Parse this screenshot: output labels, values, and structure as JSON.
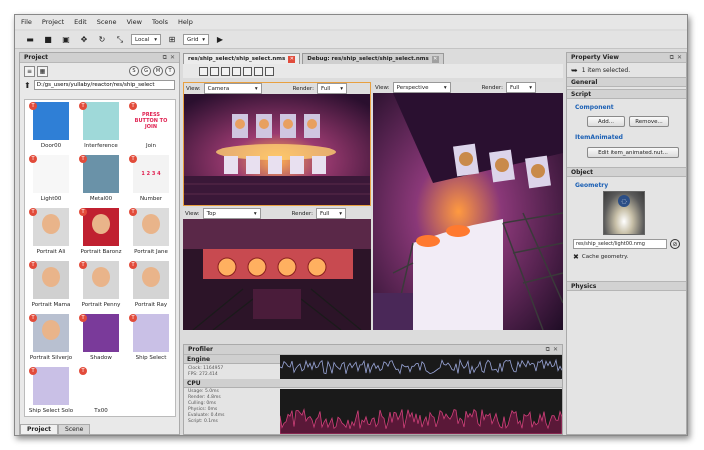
{
  "menu": [
    "File",
    "Project",
    "Edit",
    "Scene",
    "View",
    "Tools",
    "Help"
  ],
  "toolbar": {
    "space": "Local",
    "snap": "Grid"
  },
  "project": {
    "title": "Project",
    "path": "D:/gs_users/yullaby/reactor/res/ship_select",
    "assets": [
      {
        "label": "Door00",
        "bg": "#2f7fd6"
      },
      {
        "label": "Interference",
        "bg": "#9fd9d9"
      },
      {
        "label": "Join",
        "bg": "#ffffff",
        "text": "PRESS BUTTON TO JOIN"
      },
      {
        "label": "Light00",
        "bg": "#f7f7f7"
      },
      {
        "label": "Metal00",
        "bg": "#6a92a8"
      },
      {
        "label": "Number",
        "bg": "#f3f3f3",
        "text": "1 2 3 4"
      },
      {
        "label": "Portrait Ali",
        "bg": "#d9d9d9"
      },
      {
        "label": "Portrait Baronz",
        "bg": "#c02030"
      },
      {
        "label": "Portrait Jane",
        "bg": "#dcdcdc"
      },
      {
        "label": "Portrait Mama",
        "bg": "#d0d0d0"
      },
      {
        "label": "Portrait Penny",
        "bg": "#d6d6d6"
      },
      {
        "label": "Portrait Ray",
        "bg": "#d4d4d4"
      },
      {
        "label": "Portrait Silverjo",
        "bg": "#b8c0d0"
      },
      {
        "label": "Shadow",
        "bg": "#7a3a9a"
      },
      {
        "label": "Ship Select",
        "bg": "#c9c0e6"
      },
      {
        "label": "Ship Select Solo",
        "bg": "#c9c0e6"
      },
      {
        "label": "Tx00",
        "bg": "#ffffff"
      }
    ],
    "tabs": [
      "Project",
      "Scene"
    ]
  },
  "documents": [
    {
      "label": "res/ship_select/ship_select.nms",
      "active": true
    },
    {
      "label": "Debug: res/ship_select/ship_select.nms",
      "active": false
    }
  ],
  "viewports": {
    "camera": {
      "view_label": "View:",
      "view": "Camera",
      "render_label": "Render:",
      "render": "Full"
    },
    "perspective": {
      "view_label": "View:",
      "view": "Perspective",
      "render_label": "Render:",
      "render": "Full"
    },
    "top": {
      "view_label": "View:",
      "view": "Top",
      "render_label": "Render:",
      "render": "Full"
    }
  },
  "profiler": {
    "title": "Profiler",
    "engine": {
      "title": "Engine",
      "stats": [
        "Clock: 1164957",
        "FPS: 272.414"
      ]
    },
    "cpu": {
      "title": "CPU",
      "stats": [
        "Usage: 5.0ms",
        "Render: 4.8ms",
        "Culling: 0ms",
        "Physics: 0ms",
        "Evaluate: 0.4ms",
        "Script: 0.1ms"
      ]
    }
  },
  "property": {
    "title": "Property View",
    "selected": "1 item selected.",
    "general": "General",
    "script": "Script",
    "component": "Component",
    "add": "Add...",
    "remove": "Remove...",
    "item_animated": "ItemAnimated",
    "edit_item": "Edit item_animated.nut...",
    "object": "Object",
    "geometry": "Geometry",
    "geometry_path": "res/ship_select/light00.nmg",
    "cache": "Cache geometry.",
    "physics": "Physics"
  }
}
